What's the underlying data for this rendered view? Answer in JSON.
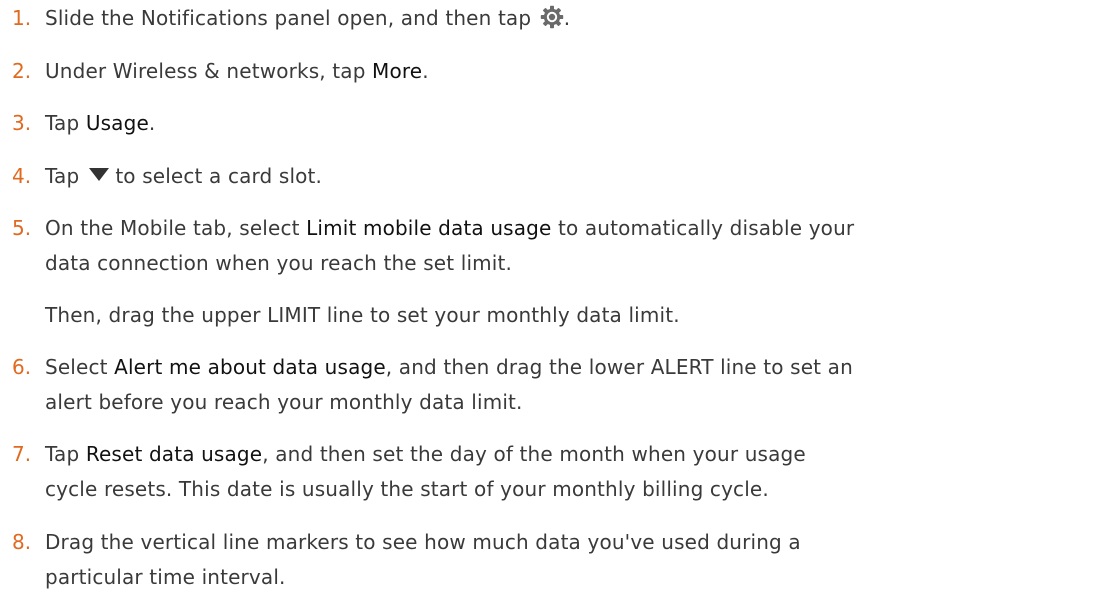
{
  "steps": [
    {
      "num": "1.",
      "p1": "Slide the Notifications panel open, and then tap",
      "icon": "settings-gear-icon",
      "p2": "."
    },
    {
      "num": "2.",
      "p1": "Under Wireless & networks, tap ",
      "kw": "More",
      "p2": "."
    },
    {
      "num": "3.",
      "p1": "Tap ",
      "kw": "Usage",
      "p2": "."
    },
    {
      "num": "4.",
      "p1": "Tap",
      "icon": "dropdown-triangle-icon",
      "p2": "to select a card slot."
    },
    {
      "num": "5.",
      "p1": "On the Mobile tab, select ",
      "kw": "Limit mobile data usage",
      "p2": " to automatically disable your",
      "l2": "data connection when you reach the set limit.",
      "extra": "Then, drag the upper LIMIT line to set your monthly data limit."
    },
    {
      "num": "6.",
      "p1": "Select ",
      "kw": "Alert me about data usage",
      "p2": ", and then drag the lower ALERT line to set an",
      "l2": "alert before you reach your monthly data limit."
    },
    {
      "num": "7.",
      "p1": "Tap ",
      "kw": "Reset data usage",
      "p2": ", and then set the day of the month when your usage",
      "l2": "cycle resets. This date is usually the start of your monthly billing cycle."
    },
    {
      "num": "8.",
      "p1": "Drag the vertical line markers to see how much data you've used during a",
      "l2": "particular time interval."
    }
  ],
  "colors": {
    "number": "#e06a20",
    "text": "#3a3a3a",
    "keyword": "#111111"
  }
}
